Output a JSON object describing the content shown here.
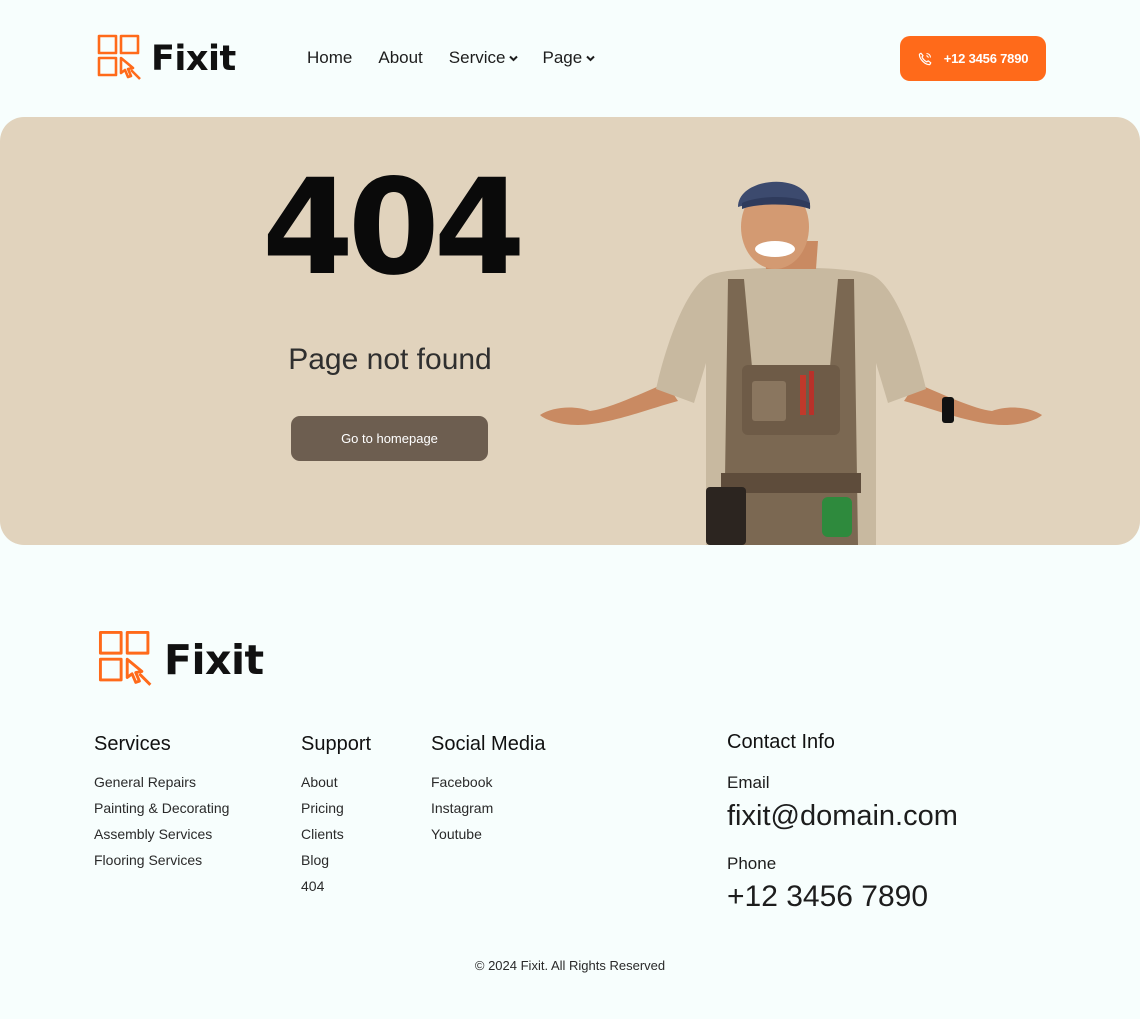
{
  "brand": {
    "name": "Fixit",
    "accent_color": "#ff6a1a",
    "icon": "fixit-logo-icon"
  },
  "nav": {
    "items": [
      {
        "label": "Home"
      },
      {
        "label": "About"
      },
      {
        "label": "Service",
        "icon": "chevron-down-icon"
      },
      {
        "label": "Page",
        "icon": "chevron-down-icon"
      }
    ],
    "phone_label": "+12 3456 7890",
    "phone_icon": "phone-icon"
  },
  "hero": {
    "code": "404",
    "subtitle": "Page not found",
    "button_label": "Go to homepage",
    "background_color": "#e1d3bd",
    "button_color": "#6d5e50",
    "image": "smiling-handyman-in-overalls-shrugging"
  },
  "footer": {
    "services": {
      "title": "Services",
      "links": [
        "General Repairs",
        "Painting & Decorating",
        "Assembly Services",
        "Flooring Services"
      ]
    },
    "support": {
      "title": "Support",
      "links": [
        "About",
        "Pricing",
        "Clients",
        "Blog",
        "404"
      ]
    },
    "social": {
      "title": "Social Media",
      "links": [
        "Facebook",
        "Instagram",
        "Youtube"
      ]
    },
    "contact": {
      "title": "Contact Info",
      "email_label": "Email",
      "email": "fixit@domain.com",
      "phone_label": "Phone",
      "phone": "+12 3456 7890"
    },
    "copyright": "© 2024 Fixit. All Rights Reserved"
  }
}
